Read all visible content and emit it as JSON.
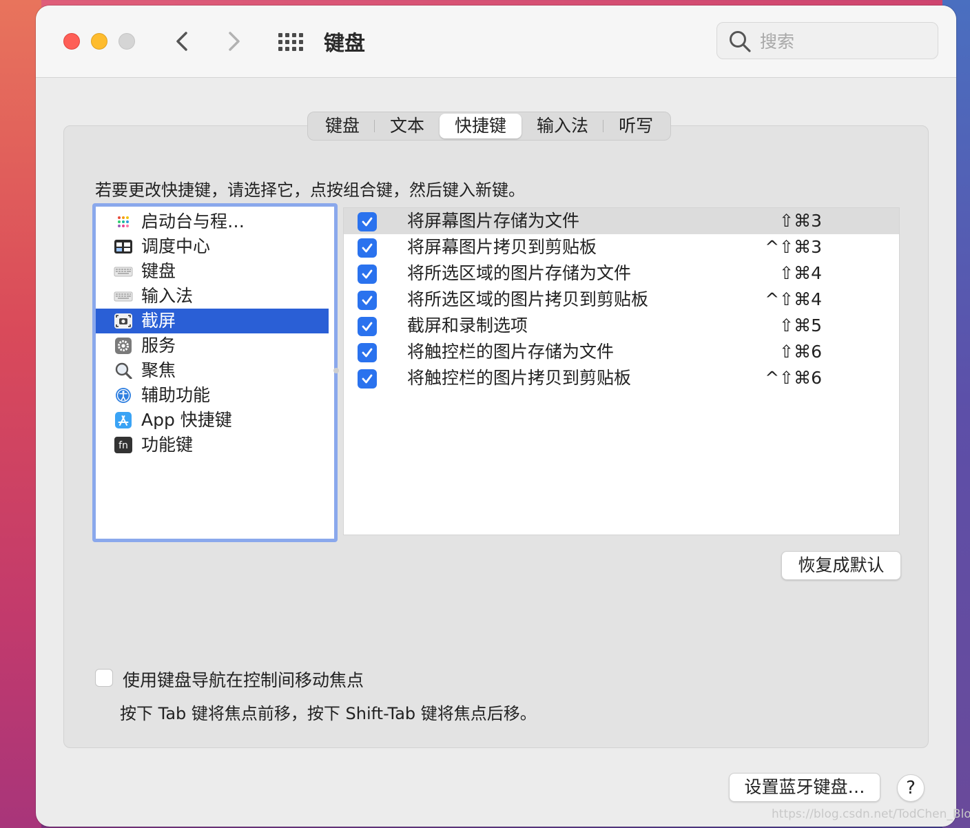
{
  "window": {
    "title": "键盘"
  },
  "search": {
    "placeholder": "搜索"
  },
  "tabs": [
    {
      "label": "键盘"
    },
    {
      "label": "文本"
    },
    {
      "label": "快捷键",
      "active": true
    },
    {
      "label": "输入法"
    },
    {
      "label": "听写"
    }
  ],
  "instruction": "若要更改快捷键，请选择它，点按组合键，然后键入新键。",
  "categories": [
    {
      "label": "启动台与程…",
      "icon": "launchpad-icon"
    },
    {
      "label": "调度中心",
      "icon": "mission-control-icon"
    },
    {
      "label": "键盘",
      "icon": "keyboard-icon"
    },
    {
      "label": "输入法",
      "icon": "input-source-icon"
    },
    {
      "label": "截屏",
      "icon": "screenshot-icon",
      "selected": true
    },
    {
      "label": "服务",
      "icon": "services-gear-icon"
    },
    {
      "label": "聚焦",
      "icon": "spotlight-icon"
    },
    {
      "label": "辅助功能",
      "icon": "accessibility-icon"
    },
    {
      "label": "App 快捷键",
      "icon": "app-store-icon"
    },
    {
      "label": "功能键",
      "icon": "fn-key-icon"
    }
  ],
  "shortcuts": [
    {
      "checked": true,
      "label": "将屏幕图片存储为文件",
      "keys": "⇧⌘3"
    },
    {
      "checked": true,
      "label": "将屏幕图片拷贝到剪贴板",
      "keys": "^⇧⌘3"
    },
    {
      "checked": true,
      "label": "将所选区域的图片存储为文件",
      "keys": "⇧⌘4"
    },
    {
      "checked": true,
      "label": "将所选区域的图片拷贝到剪贴板",
      "keys": "^⇧⌘4"
    },
    {
      "checked": true,
      "label": "截屏和录制选项",
      "keys": "⇧⌘5"
    },
    {
      "checked": true,
      "label": "将触控栏的图片存储为文件",
      "keys": "⇧⌘6"
    },
    {
      "checked": true,
      "label": "将触控栏的图片拷贝到剪贴板",
      "keys": "^⇧⌘6"
    }
  ],
  "buttons": {
    "restore_defaults": "恢复成默认",
    "bluetooth_keyboard": "设置蓝牙键盘…",
    "help": "?"
  },
  "keyboard_nav": {
    "checked": false,
    "label": "使用键盘导航在控制间移动焦点",
    "hint": "按下 Tab 键将焦点前移，按下 Shift-Tab 键将焦点后移。"
  },
  "watermark": "https://blog.csdn.net/TodChen_Blogger",
  "colors": {
    "accent": "#2a72ee",
    "selection": "#2a5fd6",
    "focus_ring": "#8aa8ec"
  }
}
